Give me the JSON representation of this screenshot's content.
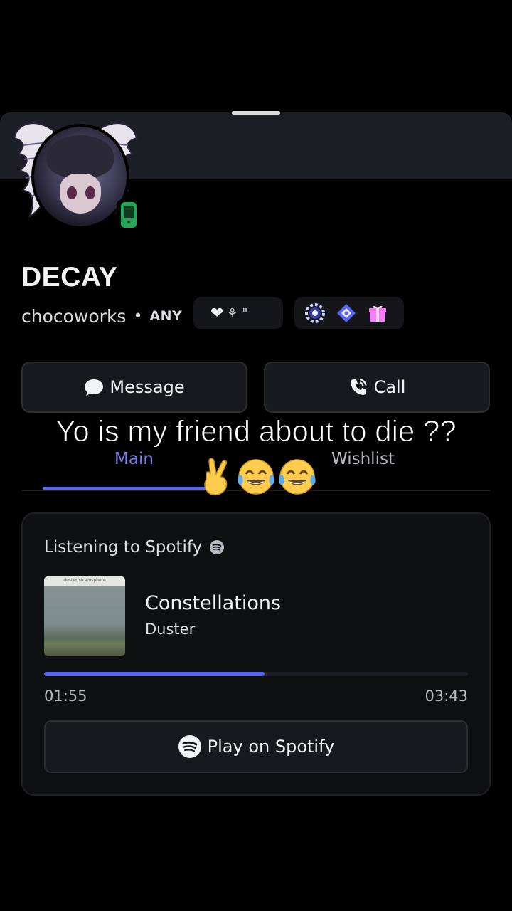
{
  "profile": {
    "display_name": "DECAY",
    "username": "chocoworks",
    "separator": "•",
    "clan_tag": "ANY",
    "status": "mobile-online",
    "decoration_text": "⚘ \""
  },
  "badges": [
    "hypesquad-icon",
    "quest-icon",
    "nitro-gift-icon"
  ],
  "actions": {
    "message_label": "Message",
    "call_label": "Call"
  },
  "overlay_caption": "Yo is my friend about to die ??",
  "overlay_emojis": "✌😂😂",
  "tabs": [
    {
      "label": "Main",
      "active": true
    },
    {
      "label": "Wishlist",
      "active": false
    }
  ],
  "activity": {
    "header": "Listening to Spotify",
    "track_title": "Constellations",
    "artist": "Duster",
    "album_art_text": "duster/stratosphere",
    "elapsed": "01:55",
    "duration": "03:43",
    "progress_fraction": 0.52,
    "play_label": "Play on Spotify"
  },
  "colors": {
    "accent": "#5865f2",
    "tab_active": "#7c7fe8",
    "online_mobile": "#23a55a"
  }
}
